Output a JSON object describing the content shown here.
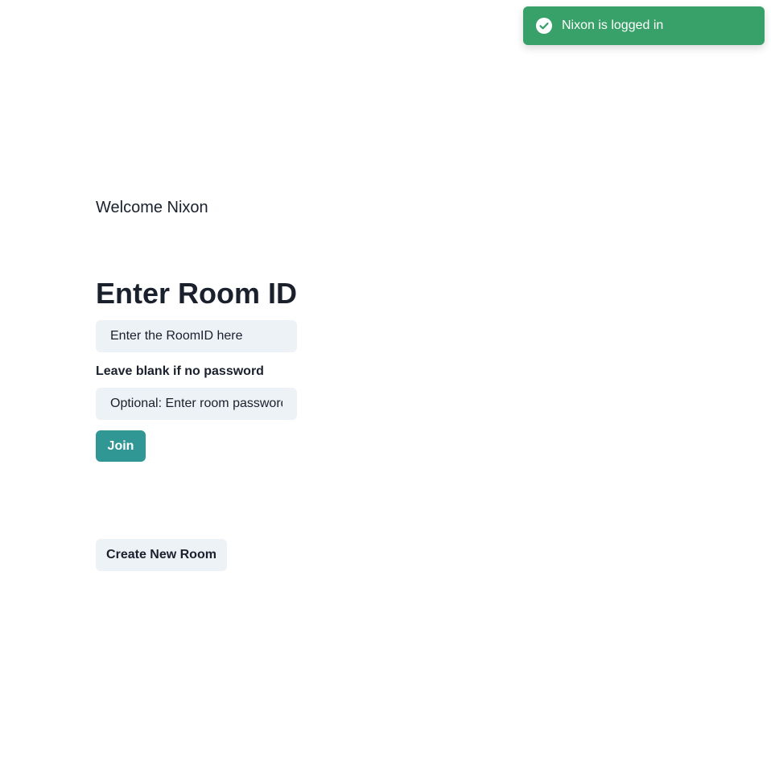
{
  "toast": {
    "message": "Nixon is logged in",
    "icon": "check-circle-icon",
    "color": "#38a169"
  },
  "welcome": {
    "text": "Welcome Nixon"
  },
  "join_form": {
    "heading": "Enter Room ID",
    "room_id_placeholder": "Enter the RoomID here",
    "room_id_value": "",
    "password_hint": "Leave blank if no password",
    "password_placeholder": "Optional: Enter room password",
    "password_value": "",
    "join_label": "Join",
    "join_color": "#319795"
  },
  "create_room": {
    "label": "Create New Room"
  }
}
